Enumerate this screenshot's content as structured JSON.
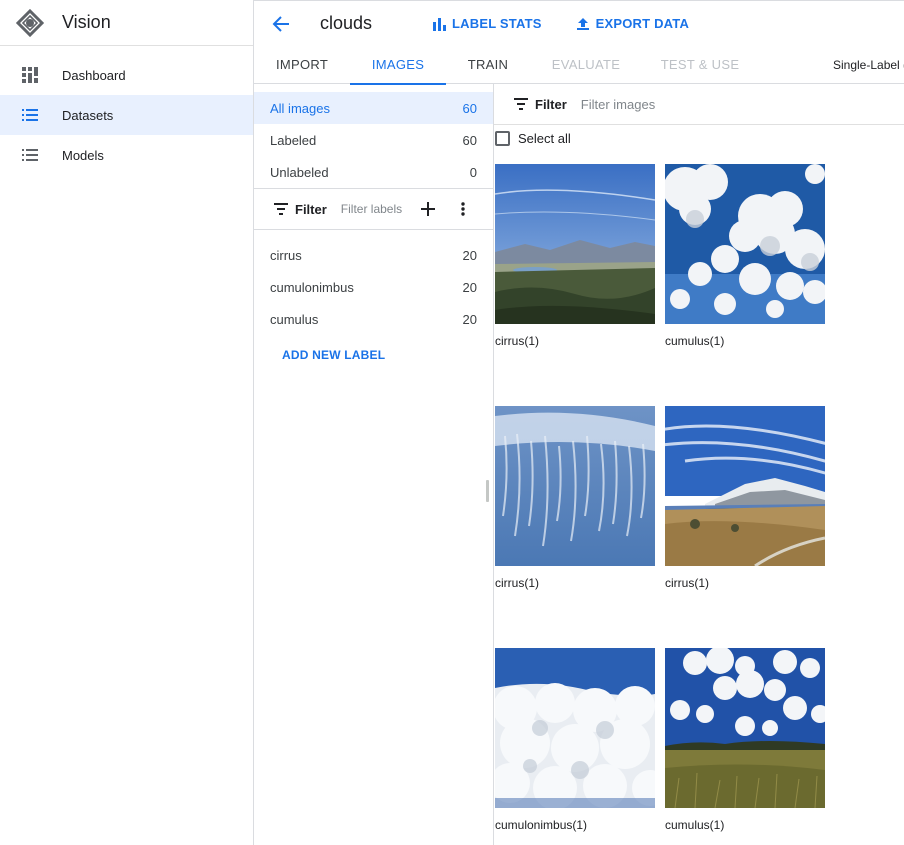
{
  "nav": {
    "brand": "Vision",
    "items": [
      {
        "label": "Dashboard",
        "icon": "dashboard-icon"
      },
      {
        "label": "Datasets",
        "icon": "list-icon",
        "active": true
      },
      {
        "label": "Models",
        "icon": "list-icon"
      }
    ]
  },
  "header": {
    "dataset_title": "clouds",
    "label_stats": "LABEL STATS",
    "export_data": "EXPORT DATA"
  },
  "tabs": [
    {
      "label": "IMPORT",
      "state": "normal"
    },
    {
      "label": "IMAGES",
      "state": "active"
    },
    {
      "label": "TRAIN",
      "state": "normal"
    },
    {
      "label": "EVALUATE",
      "state": "disabled"
    },
    {
      "label": "TEST & USE",
      "state": "disabled"
    }
  ],
  "tabs_extra": "Single-Label (",
  "counts": [
    {
      "label": "All images",
      "count": "60",
      "active": true
    },
    {
      "label": "Labeled",
      "count": "60"
    },
    {
      "label": "Unlabeled",
      "count": "0"
    }
  ],
  "label_filter": {
    "label": "Filter",
    "placeholder": "Filter labels"
  },
  "labels": [
    {
      "name": "cirrus",
      "count": "20"
    },
    {
      "name": "cumulonimbus",
      "count": "20"
    },
    {
      "name": "cumulus",
      "count": "20"
    }
  ],
  "add_label": "ADD NEW LABEL",
  "image_filter": {
    "label": "Filter",
    "placeholder": "Filter images"
  },
  "select_all": "Select all",
  "images": [
    {
      "caption": "cirrus(1)",
      "scene": "mountain-valley"
    },
    {
      "caption": "cumulus(1)",
      "scene": "cumulus-clouds"
    },
    {
      "caption": "cirrus(1)",
      "scene": "cirrus-streaks"
    },
    {
      "caption": "cirrus(1)",
      "scene": "mountain-lake"
    },
    {
      "caption": "cumulonimbus(1)",
      "scene": "cloud-tops"
    },
    {
      "caption": "cumulus(1)",
      "scene": "grass-field"
    }
  ],
  "colors": {
    "accent": "#1a73e8",
    "active_bg": "#e8f0fe",
    "disabled": "#bdc1c6"
  }
}
